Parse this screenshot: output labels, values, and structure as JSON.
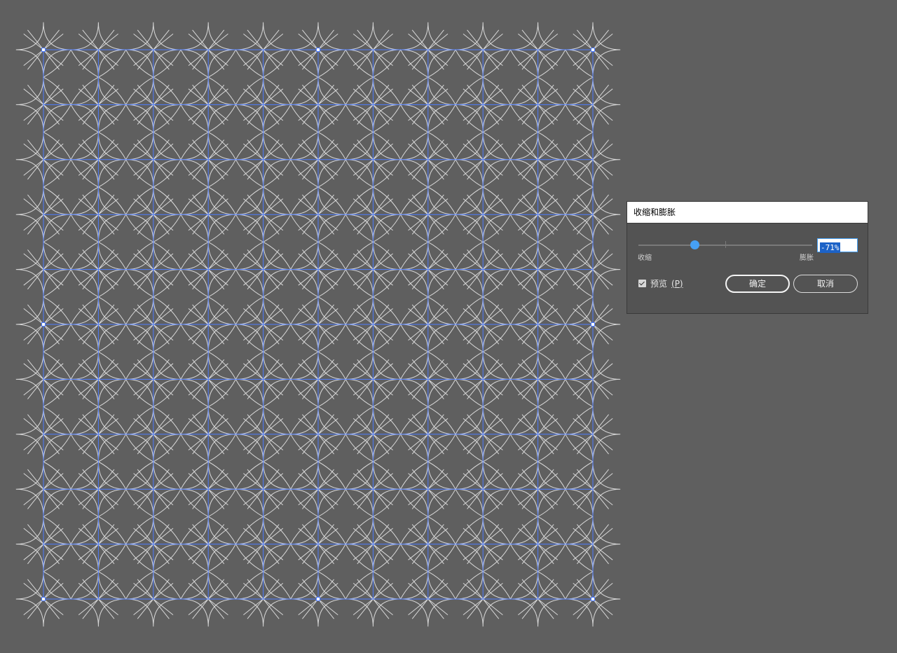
{
  "canvas": {
    "background": "#5f5f5f",
    "pattern_stroke": "#d8d8d8",
    "guide_color": "#4d7bff",
    "anchor_color": "#ffffff",
    "grid_columns": 10,
    "grid_rows": 10
  },
  "dialog": {
    "title": "收缩和膨胀",
    "slider": {
      "min_label": "收缩",
      "max_label": "膨胀",
      "value_percent": -71,
      "min": -200,
      "max": 200,
      "thumb_color": "#46a0f5"
    },
    "value_field": "-71%",
    "preview": {
      "label": "预览",
      "mnemonic": "(P)",
      "checked": true
    },
    "ok_label": "确定",
    "cancel_label": "取消"
  }
}
